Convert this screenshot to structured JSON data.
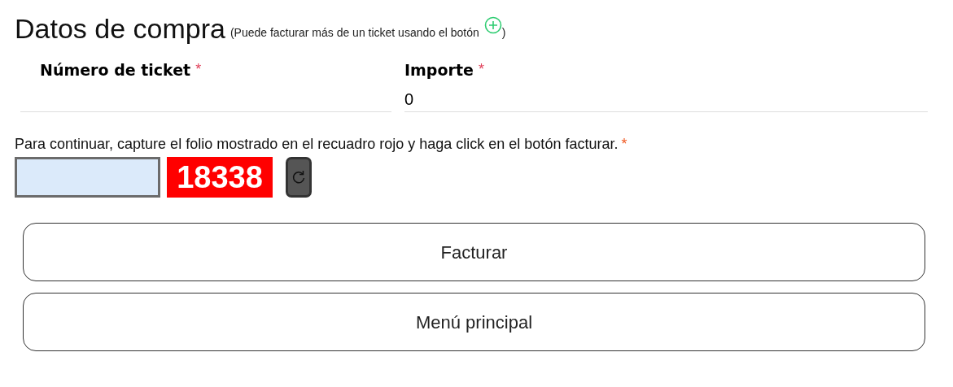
{
  "heading": {
    "title": "Datos de compra",
    "hint_before": "(Puede facturar más de un ticket usando el botón",
    "hint_after": ")"
  },
  "fields": [
    {
      "label": "Número de ticket",
      "required_mark": "*"
    },
    {
      "label": "Importe",
      "required_mark": "*",
      "value": "0"
    }
  ],
  "captcha": {
    "instruction": "Para continuar, capture el folio mostrado en el recuadro rojo y haga click en el botón facturar.",
    "required_mark": "*",
    "code": "18338"
  },
  "buttons": [
    "Facturar",
    "Menú principal"
  ]
}
